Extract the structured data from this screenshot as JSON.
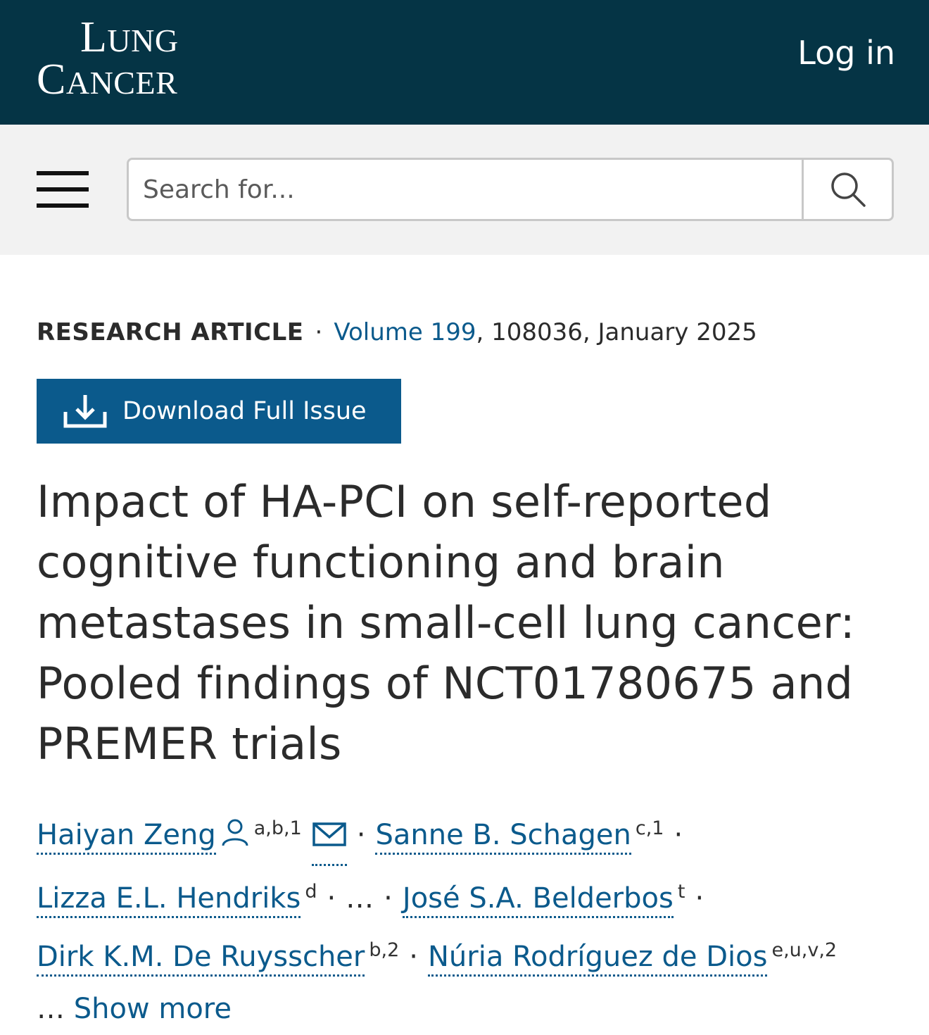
{
  "header": {
    "logo_line1": "Lung",
    "logo_line2": "Cancer",
    "login_label": "Log in"
  },
  "search": {
    "placeholder": "Search for...",
    "menu_icon": "hamburger-menu-icon",
    "search_icon": "search-icon"
  },
  "article": {
    "type": "RESEARCH ARTICLE",
    "separator": "·",
    "volume_link": "Volume 199",
    "citation_rest": ", 108036, January 2025",
    "download_label": "Download Full Issue",
    "download_icon": "download-icon",
    "title": "Impact of HA-PCI on self-reported cognitive functioning and brain metastases in small-cell lung cancer: Pooled findings of NCT01780675 and PREMER trials"
  },
  "authors": [
    {
      "name": "Haiyan Zeng",
      "sup": "a,b,1",
      "icons": [
        "person-icon",
        "email-icon"
      ]
    },
    {
      "name": "Sanne B. Schagen",
      "sup": "c,1"
    },
    {
      "name": "Lizza E.L. Hendriks",
      "sup": "d"
    },
    {
      "ellipsis": "…"
    },
    {
      "name": "José S.A. Belderbos",
      "sup": "t"
    },
    {
      "name": "Dirk K.M. De Ruysscher",
      "sup": "b,2"
    },
    {
      "name": "Núria Rodríguez de Dios",
      "sup": "e,u,v,2"
    }
  ],
  "show_more": {
    "prefix": "…",
    "label": "Show more"
  },
  "colors": {
    "header_bg": "#053445",
    "search_band_bg": "#f2f2f2",
    "link_blue": "#0b5a8c",
    "text": "#2b2b2b"
  }
}
